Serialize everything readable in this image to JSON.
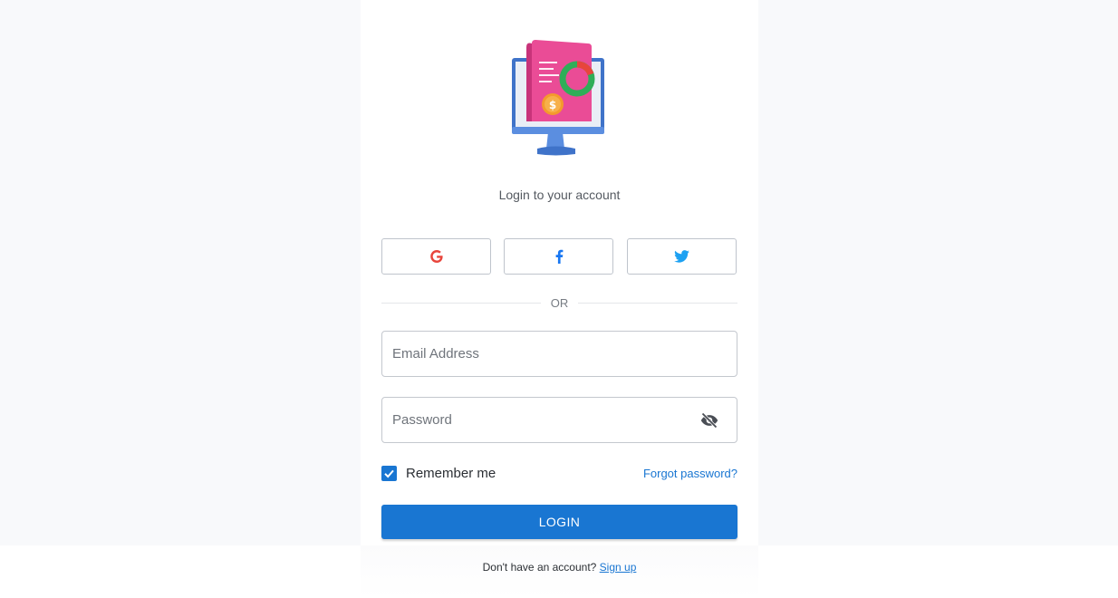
{
  "login": {
    "subtitle": "Login to your account",
    "divider_text": "OR",
    "social": [
      {
        "name": "google",
        "icon": "google-icon",
        "color": "#e8453c"
      },
      {
        "name": "facebook",
        "icon": "facebook-icon",
        "color": "#1877f2"
      },
      {
        "name": "twitter",
        "icon": "twitter-icon",
        "color": "#1da1f2"
      }
    ],
    "email": {
      "placeholder": "Email Address",
      "value": ""
    },
    "password": {
      "placeholder": "Password",
      "value": ""
    },
    "remember_me": {
      "label": "Remember me",
      "checked": true
    },
    "forgot_password": "Forgot password?",
    "login_button": "LOGIN",
    "signup_prompt": "Don't have an account?",
    "signup_link": "Sign up"
  },
  "colors": {
    "accent": "#1976d2",
    "page_background": "#f8f9fb",
    "card_background": "#ffffff"
  }
}
